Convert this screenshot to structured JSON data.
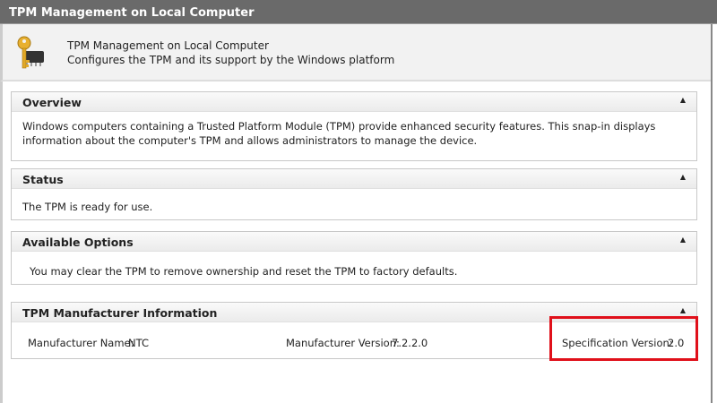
{
  "window": {
    "title": "TPM Management on Local Computer"
  },
  "header": {
    "title": "TPM Management on Local Computer",
    "subtitle": "Configures the TPM and its support by the Windows platform",
    "icon": "key-chip-icon"
  },
  "sections": {
    "overview": {
      "title": "Overview",
      "text": "Windows computers containing a Trusted Platform Module (TPM) provide enhanced security features. This snap-in displays information about the computer's TPM and allows administrators to manage the device."
    },
    "status": {
      "title": "Status",
      "text": "The TPM is ready for use."
    },
    "options": {
      "title": "Available Options",
      "text": "You may clear the TPM to remove ownership and reset the TPM to factory defaults."
    },
    "manufacturer": {
      "title": "TPM Manufacturer Information",
      "name_label": "Manufacturer Name:",
      "name_value": "NTC",
      "version_label": "Manufacturer Version:",
      "version_value": "7.2.2.0",
      "spec_label": "Specification Version:",
      "spec_value": "2.0"
    }
  },
  "collapse_glyph": "▲",
  "colors": {
    "highlight": "#e0101a"
  }
}
